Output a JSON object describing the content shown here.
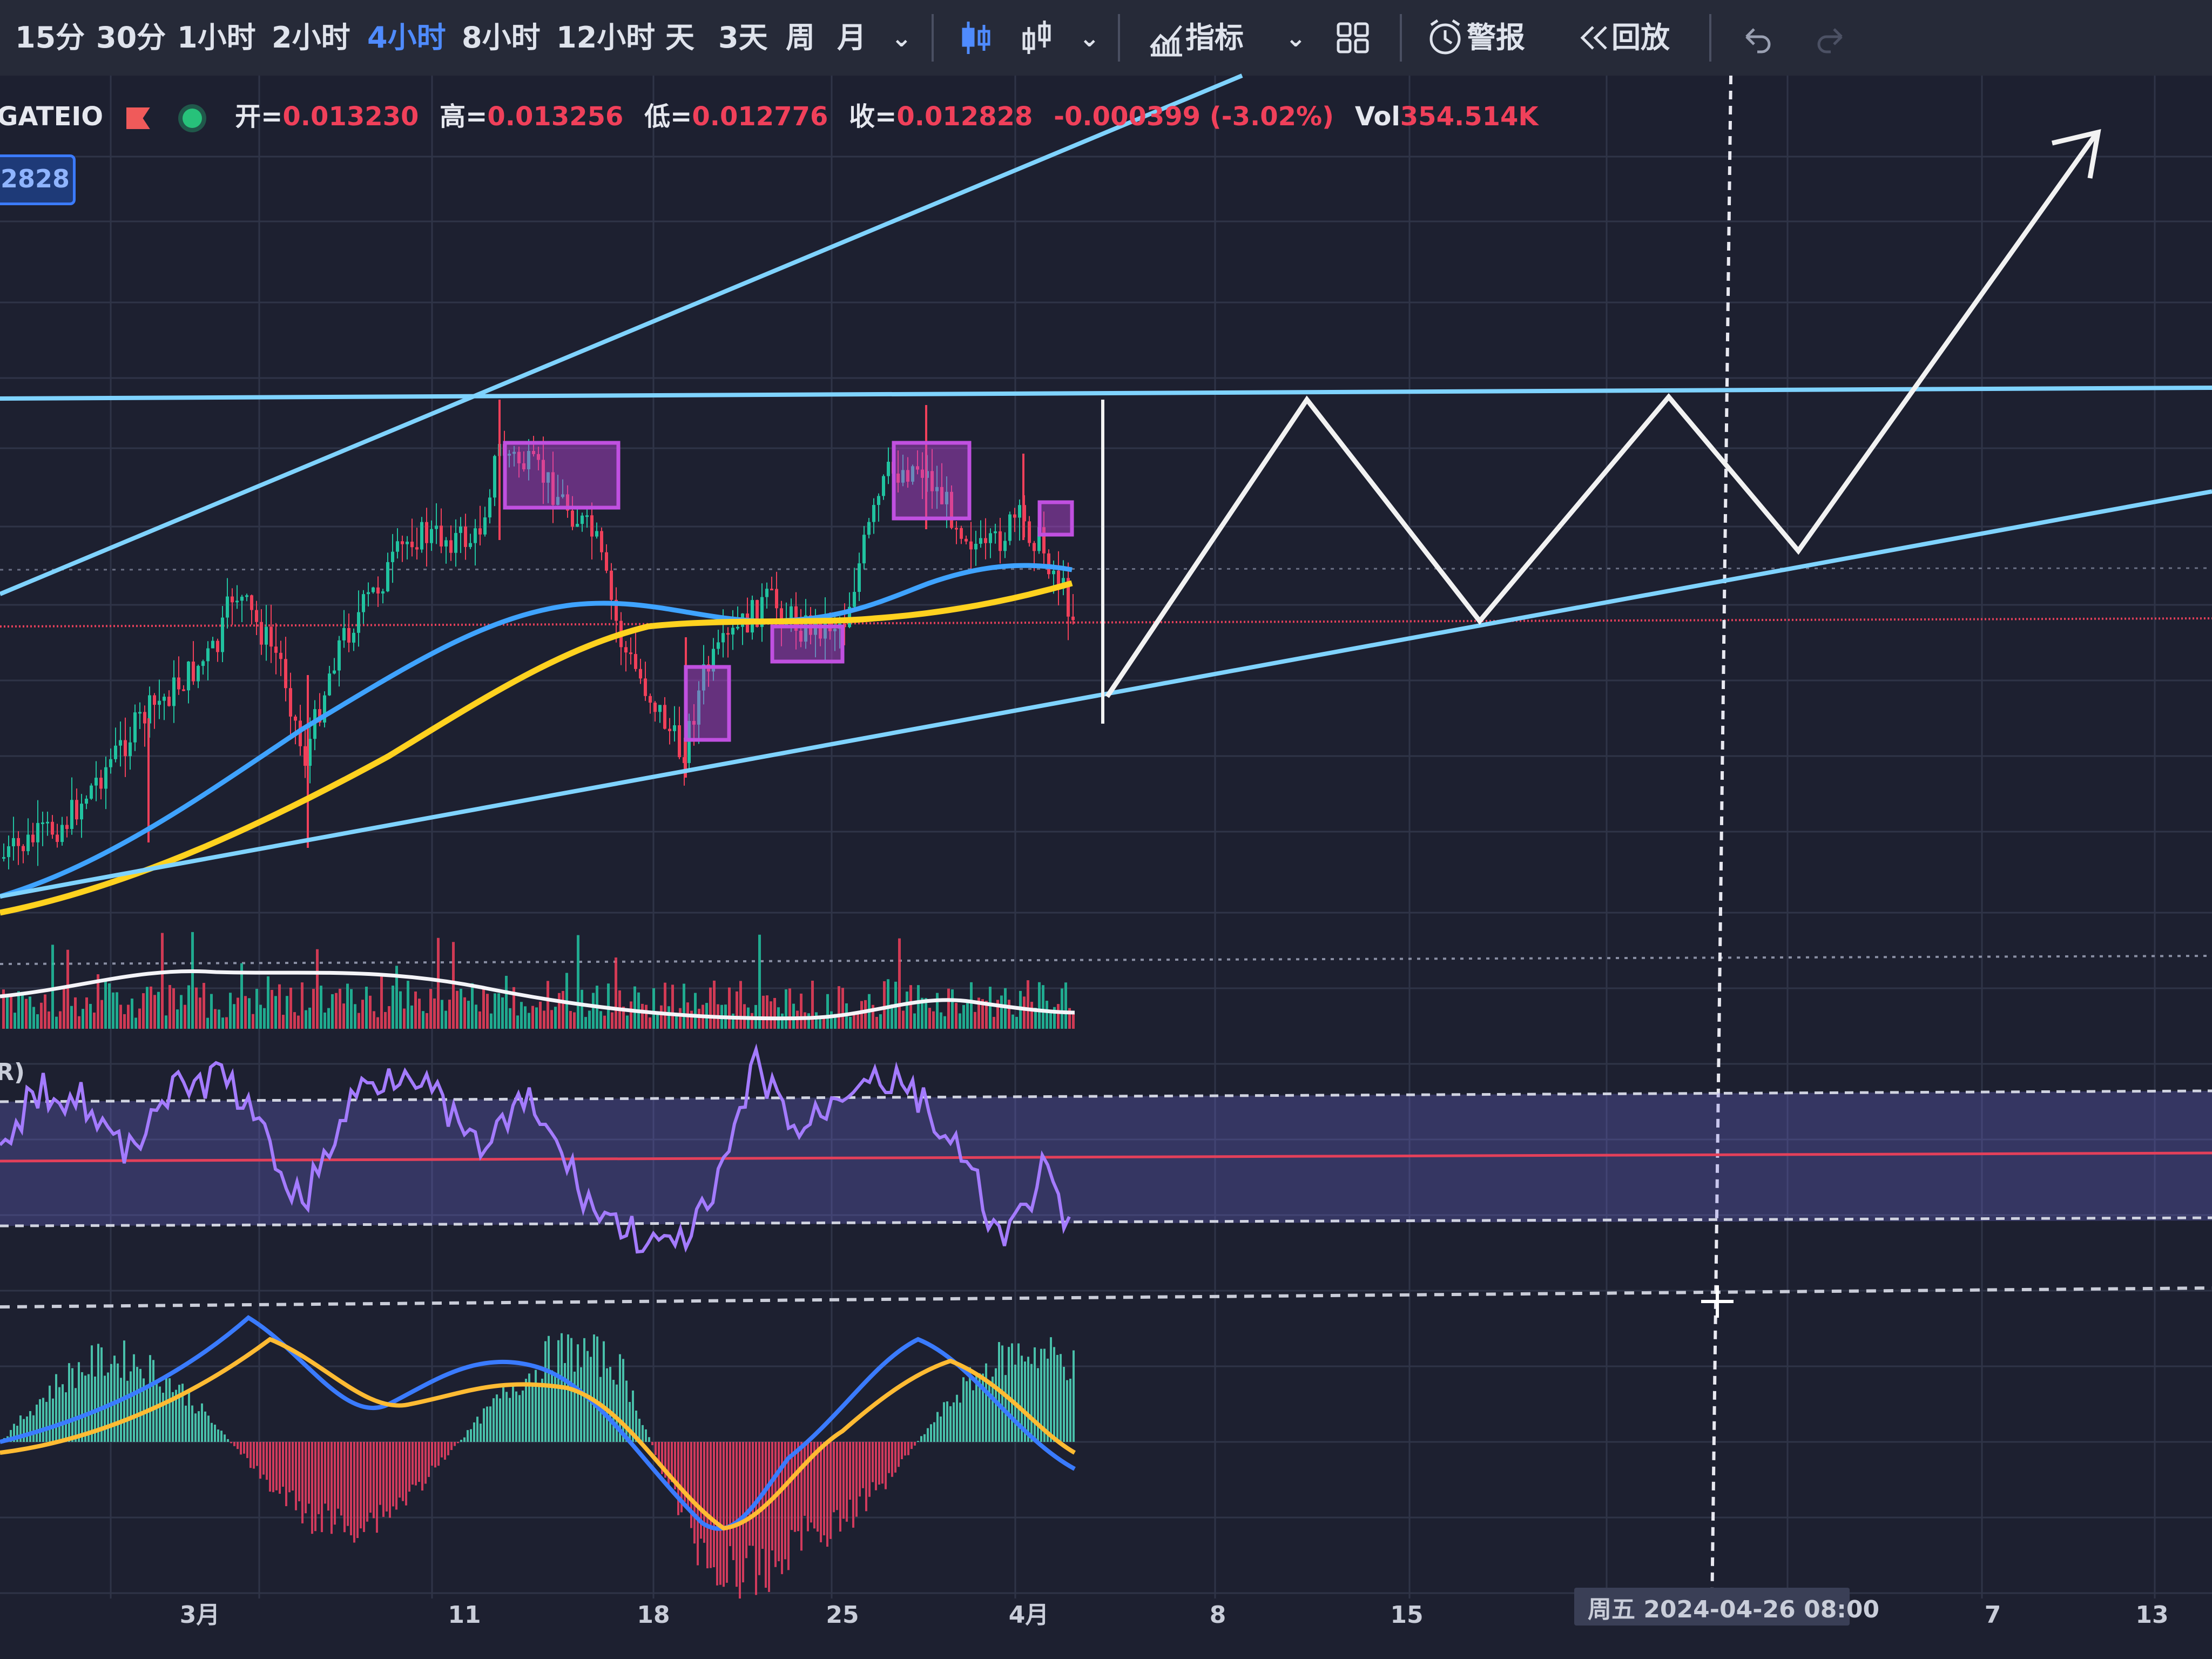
{
  "toolbar": {
    "intervals": [
      "15分",
      "30分",
      "1小时",
      "2小时",
      "4小时",
      "8小时",
      "12小时",
      "天",
      "3天",
      "周",
      "月"
    ],
    "active_interval": "4小时",
    "indicators_label": "指标",
    "alert_label": "警报",
    "replay_label": "回放"
  },
  "info": {
    "exchange": "GATEIO",
    "open_label": "开=",
    "open": "0.013230",
    "high_label": "高=",
    "high": "0.013256",
    "low_label": "低=",
    "low": "0.012776",
    "close_label": "收=",
    "close": "0.012828",
    "change": "-0.000399 (-3.02%)",
    "vol_label": "Vol",
    "vol": "354.514K"
  },
  "price_tag": "2828",
  "rsi_label": "R)",
  "colors": {
    "up": "#21c3a0",
    "down": "#f0405a",
    "ma_blue": "#3fa3ff",
    "ma_yellow": "#ffd21f",
    "trend": "#7fd3ff",
    "rsi": "#a47bff",
    "projection": "#f2f2f2",
    "highlight": "#c050e0"
  },
  "chart_data": {
    "type": "line",
    "series_kind": "candlestick with moving averages, volume, RSI and MACD panes",
    "x_tick_labels": [
      "3月",
      "11",
      "18",
      "25",
      "4月",
      "8",
      "15",
      "7",
      "13"
    ],
    "crosshair_label": "周五 2024-04-26  08:00"
  }
}
